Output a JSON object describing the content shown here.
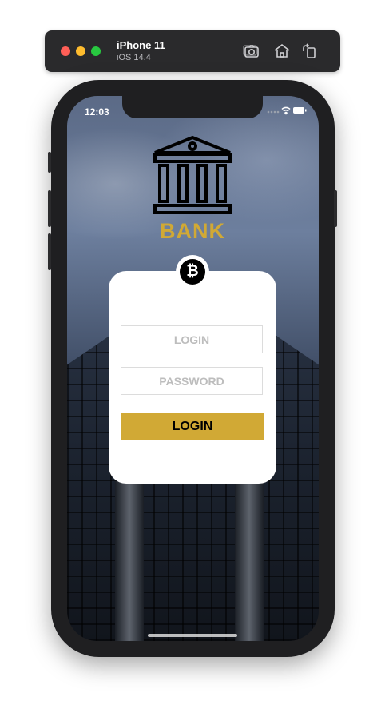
{
  "simulator": {
    "device_name": "iPhone 11",
    "os_version": "iOS 14.4",
    "toolbar_icons": [
      "screenshot-icon",
      "home-icon",
      "rotate-icon"
    ]
  },
  "status_bar": {
    "time": "12:03",
    "icons": [
      "signal-icon",
      "wifi-icon",
      "battery-icon"
    ]
  },
  "app": {
    "logo_icon": "bank-building-icon",
    "brand_name": "BANK",
    "badge_icon": "bitcoin-icon",
    "badge_symbol": "₿",
    "login_field": {
      "value": "",
      "placeholder": "LOGIN"
    },
    "password_field": {
      "value": "",
      "placeholder": "PASSWORD"
    },
    "login_button_label": "LOGIN"
  },
  "colors": {
    "accent": "#d1a935",
    "card": "#ffffff",
    "badge": "#000000"
  }
}
